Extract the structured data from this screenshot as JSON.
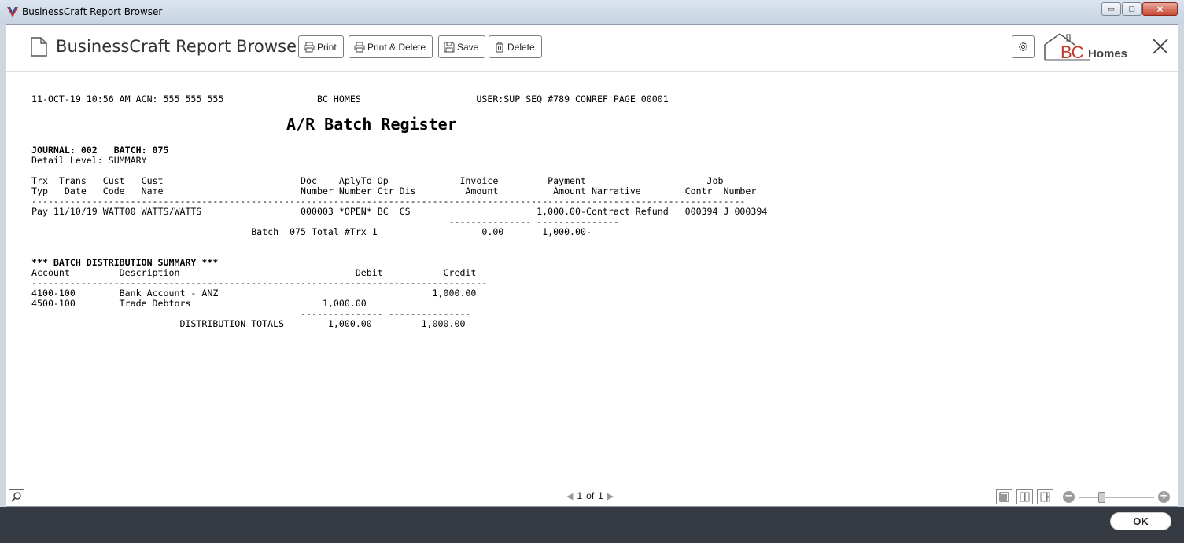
{
  "window": {
    "title": "BusinessCraft Report Browser",
    "controls": {
      "minimize": "▭",
      "maximize": "▢",
      "close": "✕"
    }
  },
  "header": {
    "title": "BusinessCraft Report Browser",
    "buttons": {
      "print": "Print",
      "print_delete": "Print & Delete",
      "save": "Save",
      "delete": "Delete"
    },
    "brand": {
      "bc": "BC",
      "homes": "Homes"
    }
  },
  "report": {
    "title": "A/R Batch Register",
    "lines": [
      "11-OCT-19 10:56 AM ACN: 555 555 555                 BC HOMES                     USER:SUP SEQ #789 CONREF PAGE 00001",
      "",
      "",
      "",
      "",
      "JOURNAL: 002   BATCH: 075",
      "Detail Level: SUMMARY",
      "",
      "Trx  Trans   Cust   Cust                         Doc    AplyTo Op             Invoice         Payment                      Job",
      "Typ   Date   Code   Name                         Number Number Ctr Dis         Amount          Amount Narrative        Contr  Number",
      "----------------------------------------------------------------------------------------------------------------------------------",
      "Pay 11/10/19 WATT00 WATTS/WATTS                  000003 *OPEN* BC  CS                       1,000.00-Contract Refund   000394 J 000394",
      "                                                                            --------------- ---------------",
      "                                        Batch  075 Total #Trx 1                   0.00       1,000.00-",
      "",
      "",
      "*** BATCH DISTRIBUTION SUMMARY ***",
      "Account         Description                                Debit           Credit",
      "-----------------------------------------------------------------------------------",
      "4100-100        Bank Account - ANZ                                       1,000.00",
      "4500-100        Trade Debtors                        1,000.00",
      "                                                 --------------- ---------------",
      "                           DISTRIBUTION TOTALS        1,000.00         1,000.00"
    ],
    "bold_lines": [
      5,
      16
    ]
  },
  "footer": {
    "page_current": "1",
    "page_of": "of",
    "page_total": "1",
    "prev": "◀",
    "next": "▶",
    "zoom_level": 0.3
  },
  "bottom": {
    "ok": "OK"
  },
  "colors": {
    "accent": "#c0392b",
    "bottom_bar": "#363b43"
  }
}
